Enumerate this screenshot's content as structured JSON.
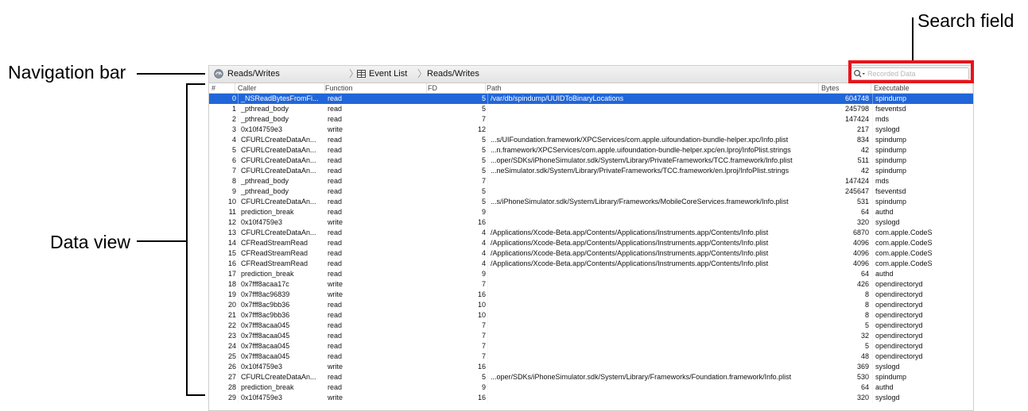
{
  "callouts": {
    "search_field": "Search field",
    "navigation_bar": "Navigation bar",
    "data_view": "Data view"
  },
  "navbar": {
    "instrument_label": "Reads/Writes",
    "instrument_icon": "gauge-icon",
    "view_label": "Event List",
    "view_icon": "table-grid-icon",
    "detail_label": "Reads/Writes",
    "search_placeholder": "Recorded Data",
    "search_icon": "search-icon"
  },
  "table": {
    "columns": [
      "#",
      "Caller",
      "Function",
      "FD",
      "Path",
      "Bytes",
      "Executable"
    ],
    "selected_row": 0,
    "rows": [
      [
        "0",
        "_NSReadBytesFromFi...",
        "read",
        "5",
        "/var/db/spindump/UUIDToBinaryLocations",
        "604748",
        "spindump"
      ],
      [
        "1",
        "_pthread_body",
        "read",
        "5",
        "",
        "245798",
        "fseventsd"
      ],
      [
        "2",
        "_pthread_body",
        "read",
        "7",
        "",
        "147424",
        "mds"
      ],
      [
        "3",
        "0x10f4759e3",
        "write",
        "12",
        "",
        "217",
        "syslogd"
      ],
      [
        "4",
        "CFURLCreateDataAn...",
        "read",
        "5",
        "...s/UIFoundation.framework/XPCServices/com.apple.uifoundation-bundle-helper.xpc/Info.plist",
        "834",
        "spindump"
      ],
      [
        "5",
        "CFURLCreateDataAn...",
        "read",
        "5",
        "...n.framework/XPCServices/com.apple.uifoundation-bundle-helper.xpc/en.lproj/InfoPlist.strings",
        "42",
        "spindump"
      ],
      [
        "6",
        "CFURLCreateDataAn...",
        "read",
        "5",
        "...oper/SDKs/iPhoneSimulator.sdk/System/Library/PrivateFrameworks/TCC.framework/Info.plist",
        "511",
        "spindump"
      ],
      [
        "7",
        "CFURLCreateDataAn...",
        "read",
        "5",
        "...neSimulator.sdk/System/Library/PrivateFrameworks/TCC.framework/en.lproj/InfoPlist.strings",
        "42",
        "spindump"
      ],
      [
        "8",
        "_pthread_body",
        "read",
        "7",
        "",
        "147424",
        "mds"
      ],
      [
        "9",
        "_pthread_body",
        "read",
        "5",
        "",
        "245647",
        "fseventsd"
      ],
      [
        "10",
        "CFURLCreateDataAn...",
        "read",
        "5",
        "...s/iPhoneSimulator.sdk/System/Library/Frameworks/MobileCoreServices.framework/Info.plist",
        "531",
        "spindump"
      ],
      [
        "11",
        "prediction_break",
        "read",
        "9",
        "",
        "64",
        "authd"
      ],
      [
        "12",
        "0x10f4759e3",
        "write",
        "16",
        "",
        "320",
        "syslogd"
      ],
      [
        "13",
        "CFURLCreateDataAn...",
        "read",
        "4",
        "/Applications/Xcode-Beta.app/Contents/Applications/Instruments.app/Contents/Info.plist",
        "6870",
        "com.apple.CodeS"
      ],
      [
        "14",
        "CFReadStreamRead",
        "read",
        "4",
        "/Applications/Xcode-Beta.app/Contents/Applications/Instruments.app/Contents/Info.plist",
        "4096",
        "com.apple.CodeS"
      ],
      [
        "15",
        "CFReadStreamRead",
        "read",
        "4",
        "/Applications/Xcode-Beta.app/Contents/Applications/Instruments.app/Contents/Info.plist",
        "4096",
        "com.apple.CodeS"
      ],
      [
        "16",
        "CFReadStreamRead",
        "read",
        "4",
        "/Applications/Xcode-Beta.app/Contents/Applications/Instruments.app/Contents/Info.plist",
        "4096",
        "com.apple.CodeS"
      ],
      [
        "17",
        "prediction_break",
        "read",
        "9",
        "",
        "64",
        "authd"
      ],
      [
        "18",
        "0x7fff8acaa17c",
        "write",
        "7",
        "",
        "426",
        "opendirectoryd"
      ],
      [
        "19",
        "0x7fff8ac96839",
        "write",
        "16",
        "",
        "8",
        "opendirectoryd"
      ],
      [
        "20",
        "0x7fff8ac9bb36",
        "read",
        "10",
        "",
        "8",
        "opendirectoryd"
      ],
      [
        "21",
        "0x7fff8ac9bb36",
        "read",
        "10",
        "",
        "8",
        "opendirectoryd"
      ],
      [
        "22",
        "0x7fff8acaa045",
        "read",
        "7",
        "",
        "5",
        "opendirectoryd"
      ],
      [
        "23",
        "0x7fff8acaa045",
        "read",
        "7",
        "",
        "32",
        "opendirectoryd"
      ],
      [
        "24",
        "0x7fff8acaa045",
        "read",
        "7",
        "",
        "5",
        "opendirectoryd"
      ],
      [
        "25",
        "0x7fff8acaa045",
        "read",
        "7",
        "",
        "48",
        "opendirectoryd"
      ],
      [
        "26",
        "0x10f4759e3",
        "write",
        "16",
        "",
        "369",
        "syslogd"
      ],
      [
        "27",
        "CFURLCreateDataAn...",
        "read",
        "5",
        "...oper/SDKs/iPhoneSimulator.sdk/System/Library/Frameworks/Foundation.framework/Info.plist",
        "530",
        "spindump"
      ],
      [
        "28",
        "prediction_break",
        "read",
        "9",
        "",
        "64",
        "authd"
      ],
      [
        "29",
        "0x10f4759e3",
        "write",
        "16",
        "",
        "320",
        "syslogd"
      ]
    ]
  },
  "colors": {
    "selection": "#2166d8",
    "callout_box": "#e8141b"
  }
}
